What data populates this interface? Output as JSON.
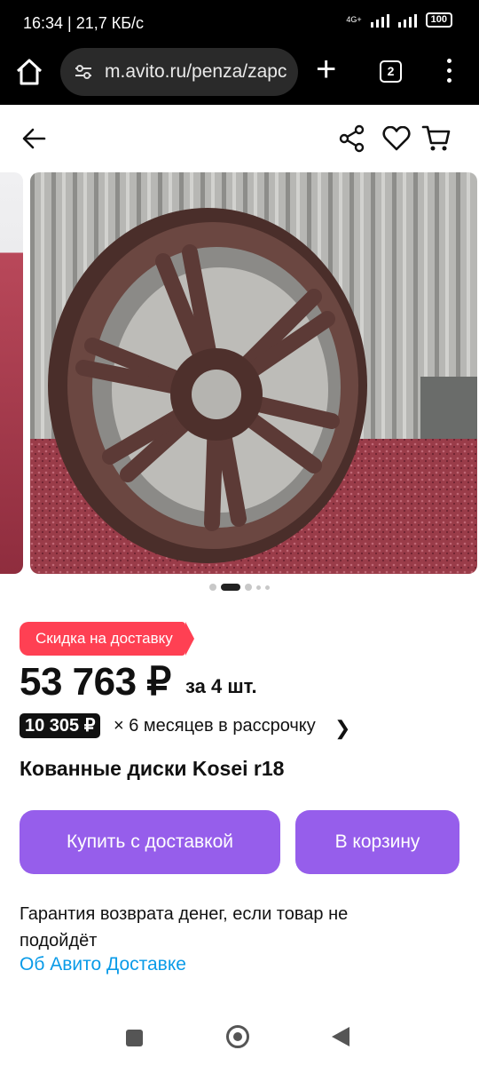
{
  "status": {
    "time_speed": "16:34 | 21,7 КБ/с",
    "network": "4G+",
    "battery": "100"
  },
  "browser": {
    "url": "m.avito.ru/penza/zapc",
    "tab_count": "2"
  },
  "gallery": {
    "total_dots": 5,
    "active_index": 1
  },
  "listing": {
    "delivery_badge": "Скидка на доставку",
    "price": "53 763 ₽",
    "price_suffix": "за 4 шт.",
    "installment_amount": "10 305 ₽",
    "installment_text": "× 6 месяцев в рассрочку",
    "title": "Кованные диски Kosei r18"
  },
  "actions": {
    "buy_with_delivery": "Купить с доставкой",
    "add_to_cart": "В корзину"
  },
  "guarantee": {
    "text": "Гарантия возврата денег, если товар не подойдёт",
    "link": "Об Авито Доставке"
  },
  "colors": {
    "badge": "#ff4053",
    "button": "#965eeb",
    "link": "#0a9be8"
  }
}
